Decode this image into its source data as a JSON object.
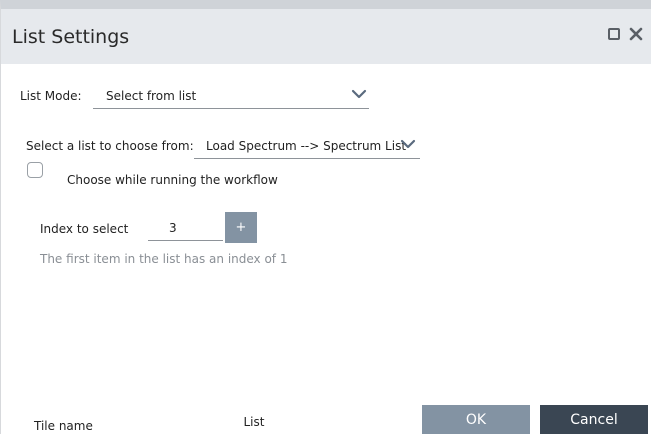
{
  "window": {
    "title": "List Settings"
  },
  "list_mode": {
    "label": "List Mode:",
    "value": "Select from list"
  },
  "source_list": {
    "label": "Select a list to choose from:",
    "value": "Load Spectrum --> Spectrum List"
  },
  "choose_while_running": {
    "label": "Choose while running the workflow",
    "checked": false
  },
  "index": {
    "label": "Index to select",
    "value": "3",
    "increment_label": "+",
    "hint": "The first item in the list has an index of 1"
  },
  "tile": {
    "label": "Tile name",
    "value": "List"
  },
  "buttons": {
    "ok": "OK",
    "cancel": "Cancel"
  },
  "colors": {
    "titlebar": "#e6e9ed",
    "primary_button": "#8393a3",
    "cancel_button": "#3a4653",
    "hint_text": "#8a8f95"
  },
  "icons": {
    "restore": "restore-icon",
    "close": "close-icon",
    "dropdown": "chevron-down-icon"
  }
}
